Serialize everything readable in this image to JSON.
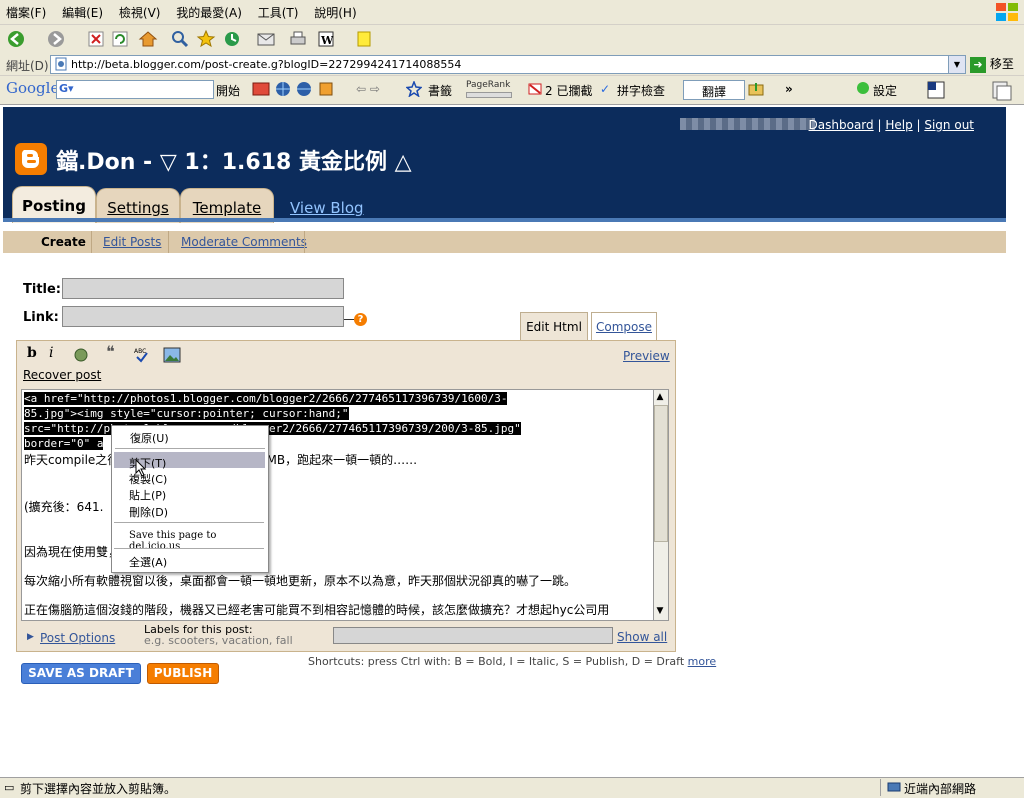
{
  "browser": {
    "menu": [
      "檔案(F)",
      "編輯(E)",
      "檢視(V)",
      "我的最愛(A)",
      "工具(T)",
      "說明(H)"
    ],
    "address_label": "網址(D)",
    "url": "http://beta.blogger.com/post-create.g?blogID=2272994241714088554",
    "go_label": "移至",
    "google": {
      "brand": "Google",
      "start": "開始",
      "bookmarks": "書籤",
      "pagerank": "PageRank",
      "blocked": "2 已攔截",
      "spell": "拼字檢查",
      "translate": "翻譯",
      "settings": "設定"
    },
    "status": "剪下選擇內容並放入剪貼簿。",
    "zone": "近端內部網路"
  },
  "header": {
    "links": [
      "Dashboard",
      "Help",
      "Sign out"
    ],
    "blog_title": "鐺.Don - ▽ 1：1.618 黃金比例 △",
    "tabs": [
      "Posting",
      "Settings",
      "Template"
    ],
    "view_blog": "View Blog"
  },
  "subnav": [
    "Create",
    "Edit Posts",
    "Moderate Comments"
  ],
  "form": {
    "title_label": "Title:",
    "link_label": "Link:",
    "edit_html_tab": "Edit Html",
    "compose_tab": "Compose",
    "toolbar_bold": "b",
    "toolbar_italic": "i",
    "preview": "Preview",
    "recover": "Recover post",
    "code_lines": [
      "<a href=\"http://photos1.blogger.com/blogger2/2666/277465117396739/1600/3-",
      "85.jpg\"><img style=\"cursor:pointer; cursor:hand;\"",
      "src=\"http://photos1.blogger.com/blogger2/2666/277465117396739/200/3-85.jpg\"",
      "border=\"0\" a"
    ],
    "body_lines": [
      "昨天compile之後，發覺記憶體居然只剩下 1 MB，跑起來一頓一頓的……",
      "(擴充後：641.",
      "因為現在使用雙，需要更多的記憶體。",
      "每次縮小所有軟體視窗以後，桌面都會一頓一頓地更新，原本不以為意，昨天那個狀況卻真的嚇了一跳。",
      "正在傷腦筋這個沒錢的階段，機器又已經老害可能買不到相容記憶體的時候，該怎麼做擴充？才想起hyc公司用"
    ],
    "post_options": "Post Options",
    "labels_head": "Labels for this post:",
    "labels_example": "e.g. scooters, vacation, fall",
    "show_all": "Show all",
    "shortcuts": "Shortcuts: press Ctrl with: B = Bold, I = Italic, S = Publish, D = Draft",
    "shortcuts_more": "more",
    "save_draft": "SAVE AS DRAFT",
    "publish": "PUBLISH"
  },
  "context_menu": {
    "items": [
      "復原(U)",
      "剪下(T)",
      "複製(C)",
      "貼上(P)",
      "刪除(D)",
      "Save this page to del.icio.us",
      "全選(A)"
    ]
  },
  "colors": {
    "header_bg": "#0c2c5c",
    "accent_orange": "#f57d00",
    "draft_blue": "#4a7fd8",
    "tab_beige": "#e6d6bd"
  }
}
